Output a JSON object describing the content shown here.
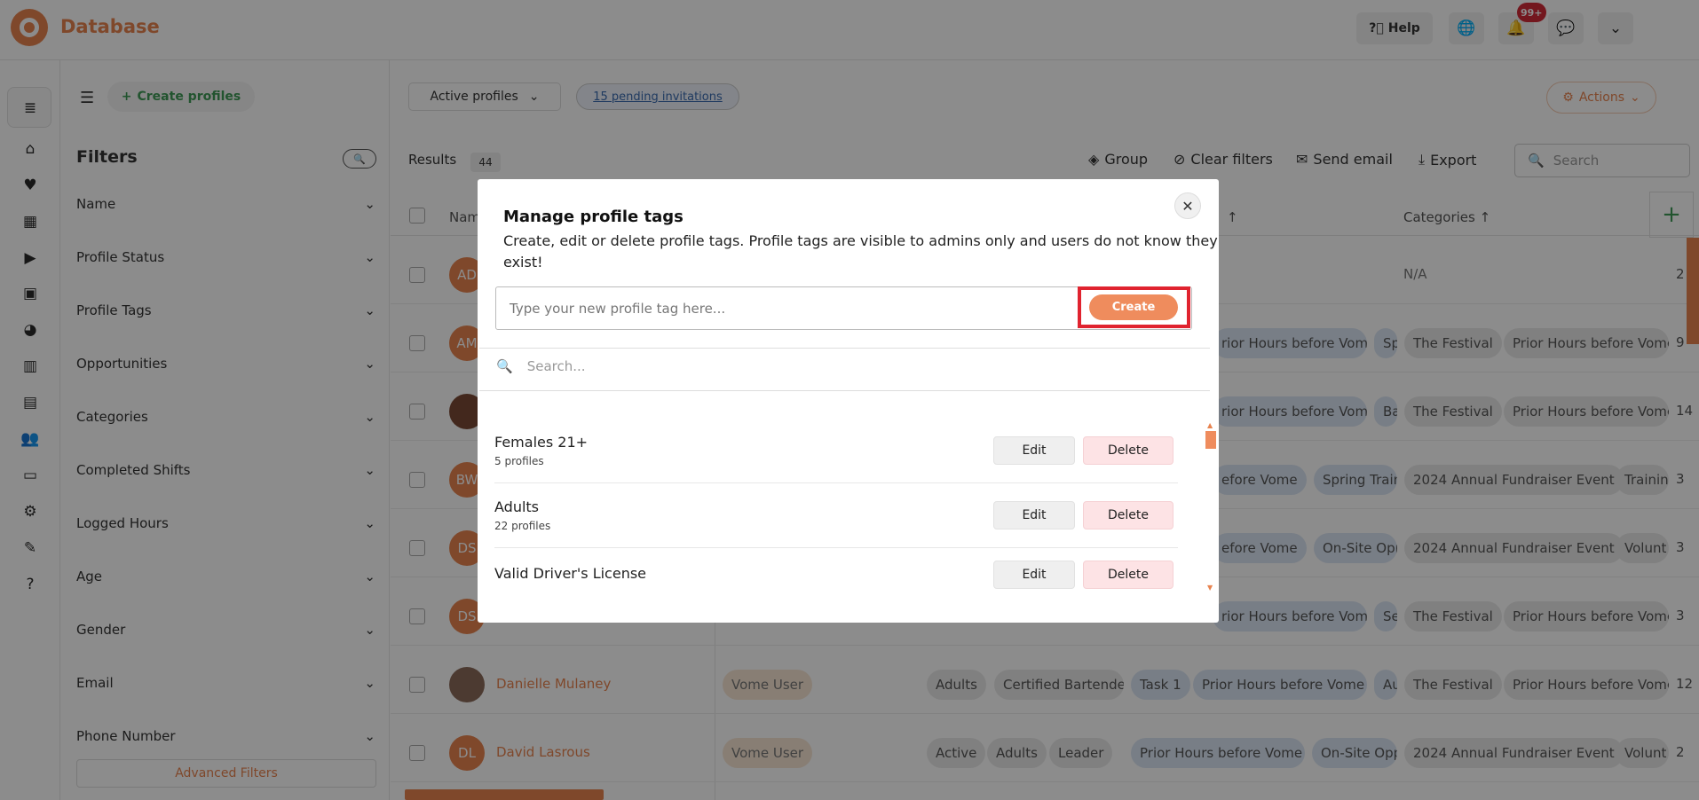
{
  "app": {
    "brand": "Database"
  },
  "topbar": {
    "help": "Help",
    "notif_badge": "99+"
  },
  "toolbar": {
    "create_profiles": "Create profiles",
    "profiles_view": "Active profiles",
    "pending": "15 pending invitations",
    "actions": "Actions"
  },
  "filters": {
    "title": "Filters",
    "items": [
      "Name",
      "Profile Status",
      "Profile Tags",
      "Opportunities",
      "Categories",
      "Completed Shifts",
      "Logged Hours",
      "Age",
      "Gender",
      "Email",
      "Phone Number"
    ],
    "advanced": "Advanced Filters"
  },
  "results": {
    "label": "Results",
    "count": "44"
  },
  "tools": {
    "group": "Group",
    "clear": "Clear filters",
    "email": "Send email",
    "export": "Export",
    "search_placeholder": "Search"
  },
  "table": {
    "headers": {
      "name": "Nam",
      "categories": "Categories"
    },
    "rows": [
      {
        "initials": "AD",
        "name": "",
        "chips": [],
        "categories": [
          "N/A"
        ],
        "last": "2"
      },
      {
        "initials": "AM",
        "name": "",
        "chips": [
          "rior Hours before Vome",
          "Sp"
        ],
        "categories": [
          "The Festival",
          "Prior Hours before Vome"
        ],
        "last": "9"
      },
      {
        "initials": "",
        "name": "",
        "chips": [
          "rior Hours before Vome",
          "Ba"
        ],
        "categories": [
          "The Festival",
          "Prior Hours before Vome"
        ],
        "last": "14"
      },
      {
        "initials": "BW",
        "name": "",
        "chips": [
          "efore Vome",
          "Spring Traini"
        ],
        "categories": [
          "2024 Annual Fundraiser Event",
          "Trainin"
        ],
        "last": "3"
      },
      {
        "initials": "DS",
        "name": "",
        "chips": [
          "efore Vome",
          "On-Site Opp"
        ],
        "categories": [
          "2024 Annual Fundraiser Event",
          "Volunt"
        ],
        "last": "3"
      },
      {
        "initials": "DS",
        "name": "",
        "chips": [
          "rior Hours before Vome",
          "Se"
        ],
        "categories": [
          "The Festival",
          "Prior Hours before Vome"
        ],
        "last": "3"
      },
      {
        "initials": "",
        "name": "Danielle Mulaney",
        "role": "Vome User",
        "chips": [
          "Adults",
          "Certified Bartender",
          "Task 1",
          "Prior Hours before Vome",
          "Au"
        ],
        "categories": [
          "The Festival",
          "Prior Hours before Vome"
        ],
        "last": "12"
      },
      {
        "initials": "DL",
        "name": "David Lasrous",
        "role": "Vome User",
        "chips": [
          "Active",
          "Adults",
          "Leader",
          "Prior Hours before Vome",
          "On-Site Opp"
        ],
        "categories": [
          "2024 Annual Fundraiser Event",
          "Volunt"
        ],
        "last": "2"
      }
    ]
  },
  "modal": {
    "title": "Manage profile tags",
    "description": "Create, edit or delete profile tags. Profile tags are visible to admins only and users do not know they exist!",
    "input_placeholder": "Type your new profile tag here...",
    "create_label": "Create",
    "search_placeholder": "Search...",
    "edit_label": "Edit",
    "delete_label": "Delete",
    "tags": [
      {
        "name": "Females 21+",
        "count": "5 profiles"
      },
      {
        "name": "Adults",
        "count": "22 profiles"
      },
      {
        "name": "Valid Driver's License",
        "count": ""
      }
    ]
  }
}
